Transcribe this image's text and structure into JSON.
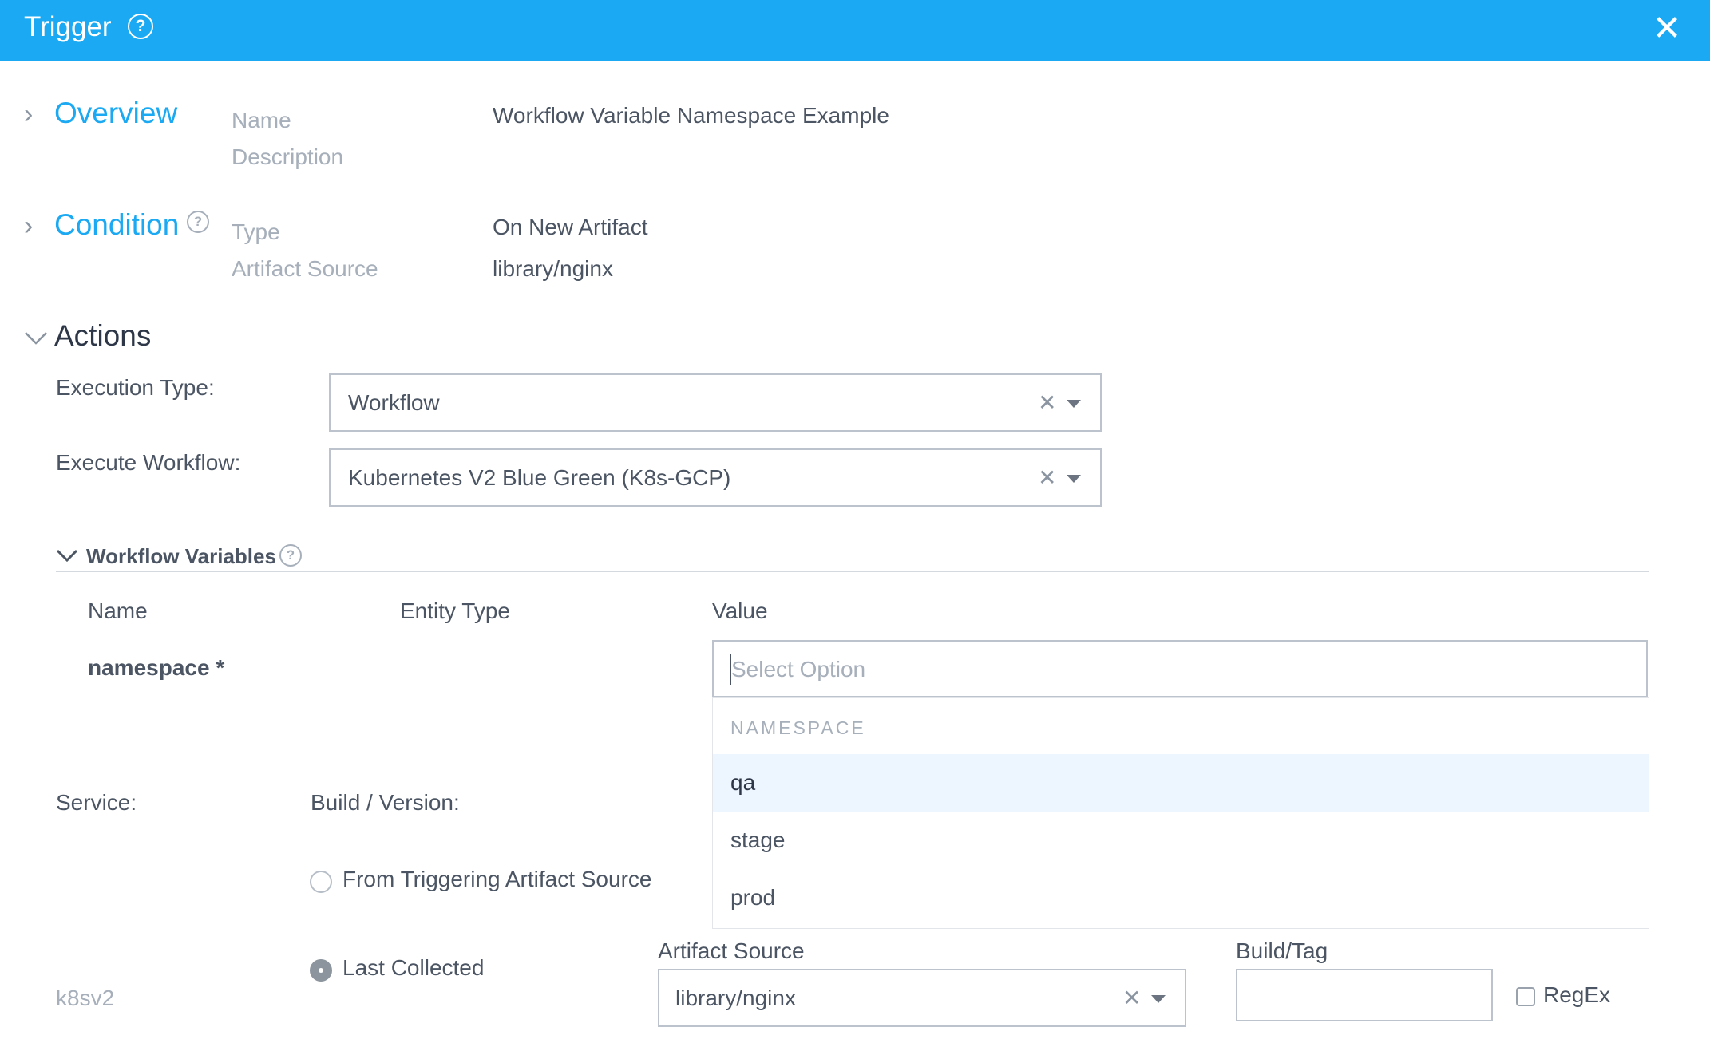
{
  "header": {
    "title": "Trigger",
    "help_icon": "help-circle-icon",
    "close_icon": "close-icon"
  },
  "overview": {
    "title": "Overview",
    "name_label": "Name",
    "name_value": "Workflow Variable Namespace Example",
    "description_label": "Description"
  },
  "condition": {
    "title": "Condition",
    "type_label": "Type",
    "type_value": "On New Artifact",
    "artifact_source_label": "Artifact Source",
    "artifact_source_value": "library/nginx"
  },
  "actions": {
    "title": "Actions",
    "execution_type_label": "Execution Type:",
    "execution_type_value": "Workflow",
    "execute_workflow_label": "Execute Workflow:",
    "execute_workflow_value": "Kubernetes V2 Blue Green (K8s-GCP)"
  },
  "workflow_variables": {
    "title": "Workflow Variables",
    "columns": [
      "Name",
      "Entity Type",
      "Value"
    ],
    "row_name": "namespace *",
    "value_placeholder": "Select Option",
    "dropdown": {
      "group_label": "NAMESPACE",
      "options": [
        "qa",
        "stage",
        "prod"
      ],
      "highlighted": "qa"
    }
  },
  "service": {
    "service_label": "Service:",
    "build_version_label": "Build / Version:",
    "option_triggering": "From Triggering Artifact Source",
    "option_last_collected": "Last Collected",
    "selected_option": "Last Collected",
    "service_name": "k8sv2",
    "artifact_source_label": "Artifact Source",
    "artifact_source_value": "library/nginx",
    "build_tag_label": "Build/Tag",
    "build_tag_value": "",
    "regex_label": "RegEx",
    "regex_checked": false
  },
  "colors": {
    "header_bg": "#1aa9f2",
    "accent": "#1aa9f2",
    "highlight_bg": "#edf5fe"
  }
}
